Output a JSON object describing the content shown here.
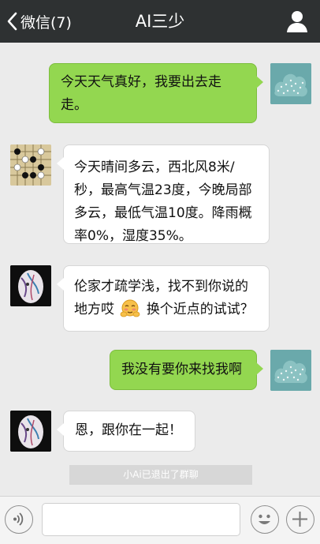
{
  "header": {
    "back_label": "微信(7)",
    "title": "AI三少"
  },
  "messages": [
    {
      "side": "out",
      "text": "今天天气真好，我要出去走走。"
    },
    {
      "side": "in",
      "text": "今天晴间多云，西北风8米/秒，最高气温23度，今晚局部多云，最低气温10度。降雨概率0%，湿度35%。"
    },
    {
      "side": "in",
      "text_before_emoji": "伦家才疏学浅，找不到你说的地方哎",
      "emoji": "shy-face",
      "text_after_emoji": "换个近点的试试？"
    },
    {
      "side": "out",
      "text": "我没有要你来找我啊"
    },
    {
      "side": "in",
      "text": "恩，跟你在一起！"
    }
  ],
  "system_notice": "小Ai已退出了群聊",
  "input_bar": {
    "value": "",
    "voice_icon": "voice-icon",
    "emoji_icon": "smiley-icon",
    "more_icon": "plus-icon"
  },
  "colors": {
    "topbar": "#2e3132",
    "outgoing_bubble": "#93d750",
    "incoming_bubble": "#ffffff",
    "background": "#ebebeb"
  }
}
